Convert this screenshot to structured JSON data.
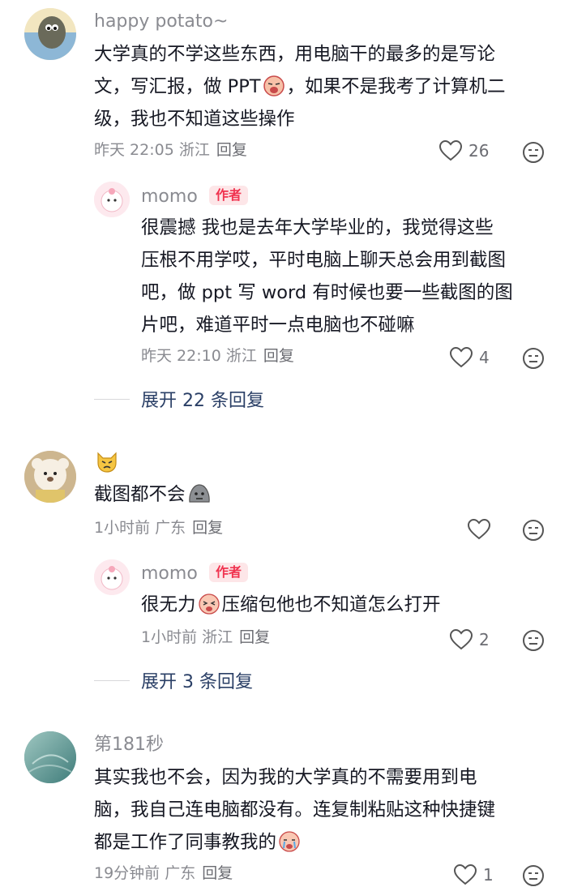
{
  "comments": [
    {
      "username": "happy potato~",
      "text_lines": [
        "大学真的不学这些东西，用电脑干的最多的是写论",
        "文，写汇报，做 PPT",
        "，如果不是我考了计算机二",
        "级，我也不知道这些操作"
      ],
      "meta": "昨天 22:05 浙江",
      "reply_label": "回复",
      "likes": "26",
      "reply": {
        "username": "momo",
        "badge": "作者",
        "text_lines": [
          "很震撼 我也是去年大学毕业的，我觉得这些",
          "压根不用学哎，平时电脑上聊天总会用到截图",
          "吧，做 ppt 写 word 有时候也要一些截图的图",
          "片吧，难道平时一点电脑也不碰嘛"
        ],
        "meta": "昨天 22:10 浙江",
        "reply_label": "回复",
        "likes": "4"
      },
      "expand_label": "展开 22 条回复"
    },
    {
      "username": "",
      "text_lines": [
        "截图都不会"
      ],
      "meta": "1小时前 广东",
      "reply_label": "回复",
      "likes": "",
      "reply": {
        "username": "momo",
        "badge": "作者",
        "text_before": "很无力",
        "text_after": "压缩包他也不知道怎么打开",
        "meta": "1小时前 浙江",
        "reply_label": "回复",
        "likes": "2"
      },
      "expand_label": "展开 3 条回复"
    },
    {
      "username": "第181秒",
      "text_lines": [
        "其实我也不会，因为我的大学真的不需要用到电",
        "脑，我自己连电脑都没有。连复制粘贴这种快捷键",
        "都是工作了同事教我的"
      ],
      "meta": "19分钟前 广东",
      "reply_label": "回复",
      "likes": "1"
    }
  ],
  "colors": {
    "name_gray": "#8a8b91",
    "text": "#161823",
    "badge_bg": "#fde6e8",
    "badge_text": "#f0334f",
    "expand_text": "#2a3f66"
  }
}
